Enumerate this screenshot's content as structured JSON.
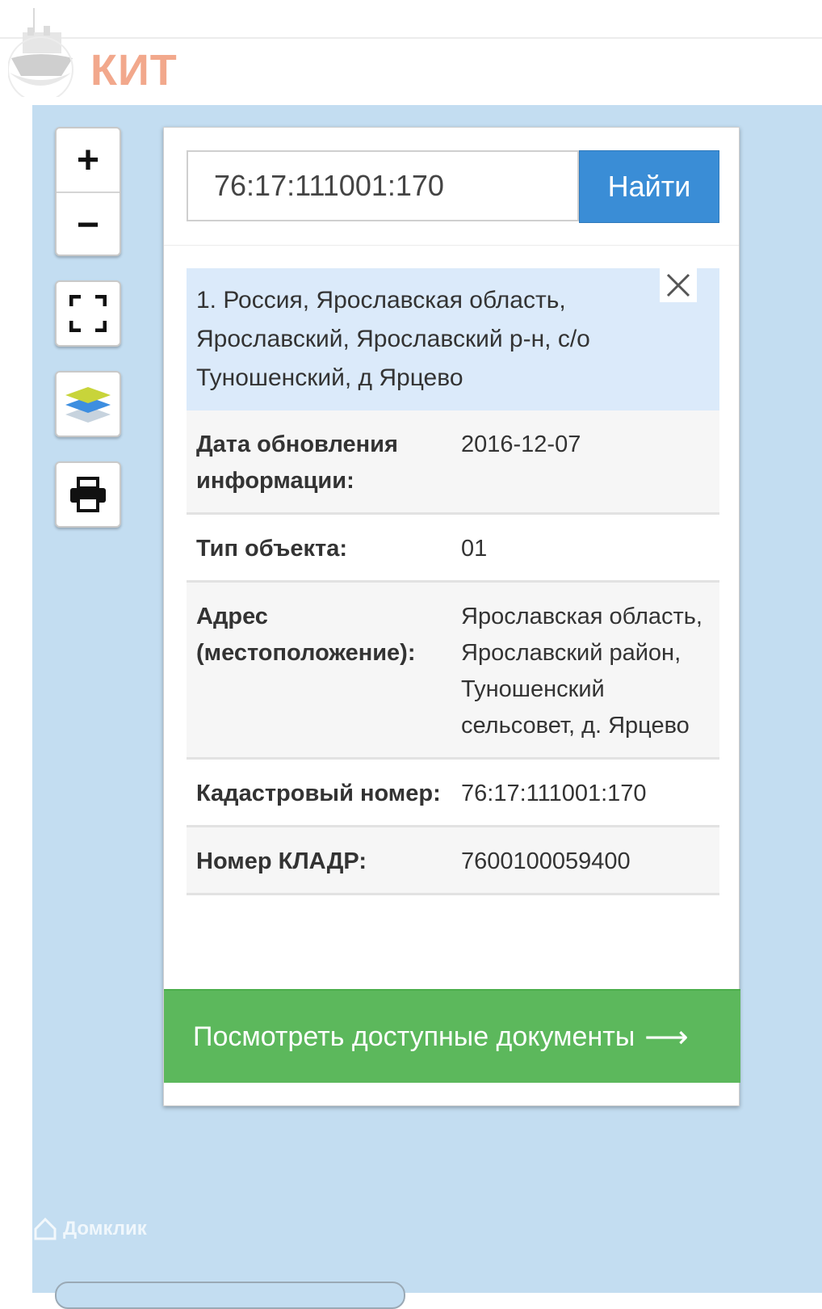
{
  "header": {
    "logo_text": "КИТ"
  },
  "map_controls": {
    "zoom_in_label": "+",
    "zoom_out_label": "−",
    "fullscreen_icon": "fullscreen-icon",
    "layers_icon": "layers-icon",
    "print_icon": "print-icon"
  },
  "search": {
    "value": "76:17:111001:170",
    "button_label": "Найти"
  },
  "result": {
    "title": "1. Россия, Ярославская область, Ярославский, Ярославский р-н, с/о Туношенский, д Ярцево",
    "close_icon": "close-icon",
    "rows": [
      {
        "label": "Дата обновления информации:",
        "value": "2016-12-07"
      },
      {
        "label": "Тип объекта:",
        "value": "01"
      },
      {
        "label": "Адрес (местоположение):",
        "value": "Ярославская область, Ярославский район, Туношенский сельсовет, д. Ярцево"
      },
      {
        "label": "Кадастровый номер:",
        "value": "76:17:111001:170"
      },
      {
        "label": "Номер КЛАДР:",
        "value": "7600100059400"
      }
    ]
  },
  "docs_button": {
    "label": "Посмотреть доступные документы",
    "arrow": "⟶"
  },
  "watermark": {
    "text": "Домклик"
  },
  "colors": {
    "search_button": "#3a8dd6",
    "docs_button": "#5cb85c",
    "map_bg": "#c3ddf1",
    "logo": "#f2a88c"
  }
}
